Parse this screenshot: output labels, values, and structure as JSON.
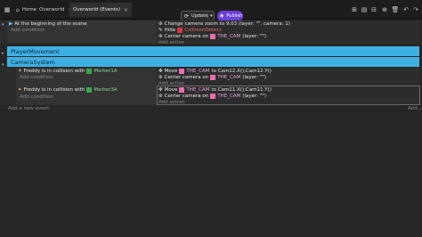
{
  "tabs": [
    {
      "label": "Home"
    },
    {
      "label": "Overworld"
    },
    {
      "label": "Overworld (Events)"
    }
  ],
  "toolbar": {
    "update_label": "Update",
    "publish_label": "Publish"
  },
  "events": {
    "ev1": {
      "cond": "At the beginning of the scene",
      "add_condition": "Add condition",
      "act1": "Change camera zoom to 9.03 (layer: \"\", camera: 1)",
      "act2_prefix": "Hide",
      "act2_obj": "CollisionDetect",
      "act3_prefix": "Center camera on",
      "act3_obj": "THE_CAM",
      "act3_suffix": "(layer: \"\")",
      "add_action": "Add action"
    },
    "group1": "PlayerMovement",
    "group2": "CameraSystem",
    "ev2": {
      "cond_prefix": "Freddy is in collision with",
      "cond_obj": "Marker1A",
      "add_condition": "Add condition",
      "act1_prefix": "Move",
      "act1_obj": "THE_CAM",
      "act1_suffix": "to Cam12.X();Cam12.Y()",
      "act2_prefix": "Center camera on",
      "act2_obj": "THE_CAM",
      "act2_suffix": "(layer: \"\")",
      "add_action": "Add action"
    },
    "ev3": {
      "cond_prefix": "Freddy is in collision with",
      "cond_obj": "Marker3A",
      "add_condition": "Add condition",
      "act1_prefix": "Move",
      "act1_obj": "THE_CAM",
      "act1_suffix": "to Cam11.X();Cam11.Y()",
      "act2_prefix": "Center camera on",
      "act2_obj": "THE_CAM",
      "act2_suffix": "(layer: \"\")",
      "add_action": "Add action"
    }
  },
  "footer": {
    "add_event": "Add a new event",
    "more": "Add..."
  }
}
